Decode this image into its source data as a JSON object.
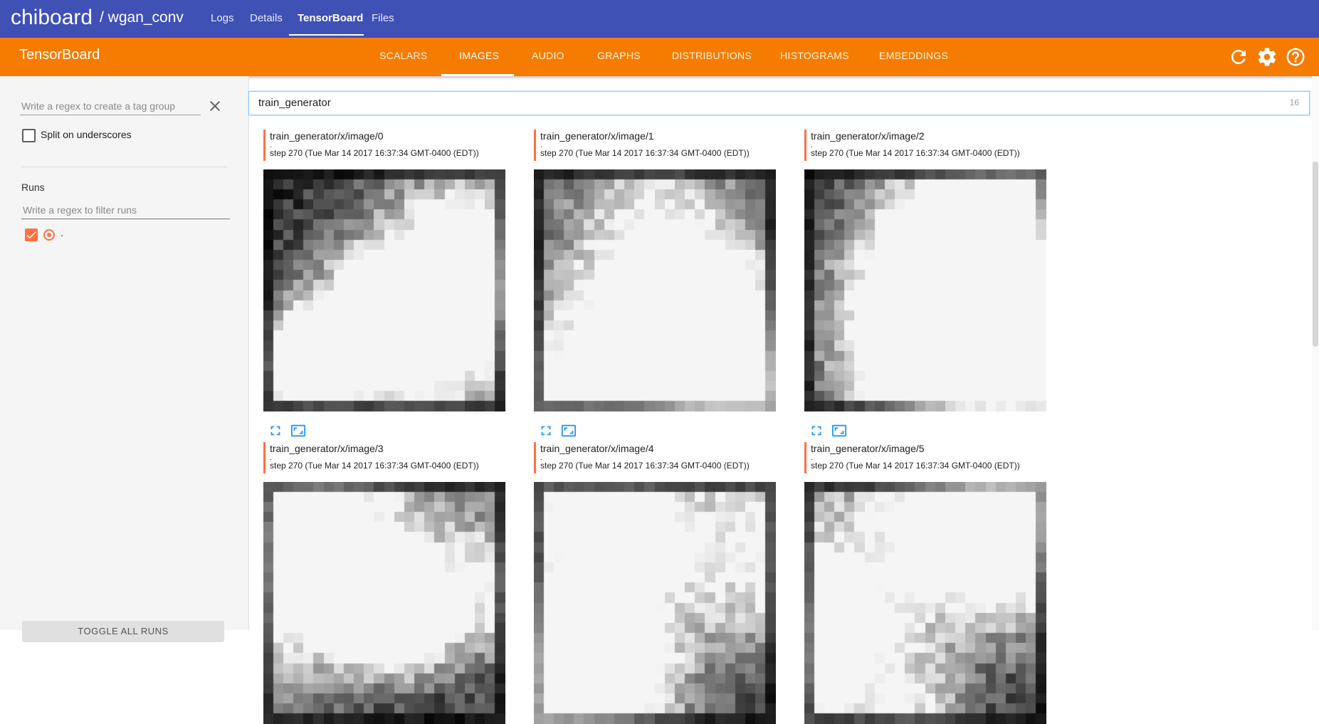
{
  "topbar": {
    "brand": "chiboard",
    "project": "/ wgan_conv",
    "links": [
      "Logs",
      "Details",
      "TensorBoard",
      "Files"
    ],
    "active_link": "TensorBoard",
    "color": "#3f51b5"
  },
  "tensorboard": {
    "title": "TensorBoard",
    "tabs": [
      "SCALARS",
      "IMAGES",
      "AUDIO",
      "GRAPHS",
      "DISTRIBUTIONS",
      "HISTOGRAMS",
      "EMBEDDINGS"
    ],
    "active_tab": "IMAGES",
    "color": "#f57c00",
    "icons": [
      "refresh-icon",
      "settings-gear-icon",
      "help-icon"
    ]
  },
  "sidebar": {
    "tag_placeholder": "Write a regex to create a tag group",
    "split_label": "Split on underscores",
    "split_checked": false,
    "runs_label": "Runs",
    "run_filter_placeholder": "Write a regex to filter runs",
    "runs": [
      {
        "name": ".",
        "checked": true,
        "color": "#ff7043"
      }
    ],
    "toggle_label": "TOGGLE ALL RUNS"
  },
  "main": {
    "search_value": "train_generator",
    "search_count": "16",
    "cards": [
      {
        "title": "train_generator/x/image/0",
        "run": ".",
        "step": "step 270 (Tue Mar 14 2017 16:37:34 GMT-0400 (EDT))"
      },
      {
        "title": "train_generator/x/image/1",
        "run": ".",
        "step": "step 270 (Tue Mar 14 2017 16:37:34 GMT-0400 (EDT))"
      },
      {
        "title": "train_generator/x/image/2",
        "run": ".",
        "step": "step 270 (Tue Mar 14 2017 16:37:34 GMT-0400 (EDT))"
      },
      {
        "title": "train_generator/x/image/3",
        "run": ".",
        "step": "step 270 (Tue Mar 14 2017 16:37:34 GMT-0400 (EDT))"
      },
      {
        "title": "train_generator/x/image/4",
        "run": ".",
        "step": "step 270 (Tue Mar 14 2017 16:37:34 GMT-0400 (EDT))"
      },
      {
        "title": "train_generator/x/image/5",
        "run": ".",
        "step": "step 270 (Tue Mar 14 2017 16:37:34 GMT-0400 (EDT))"
      }
    ]
  }
}
